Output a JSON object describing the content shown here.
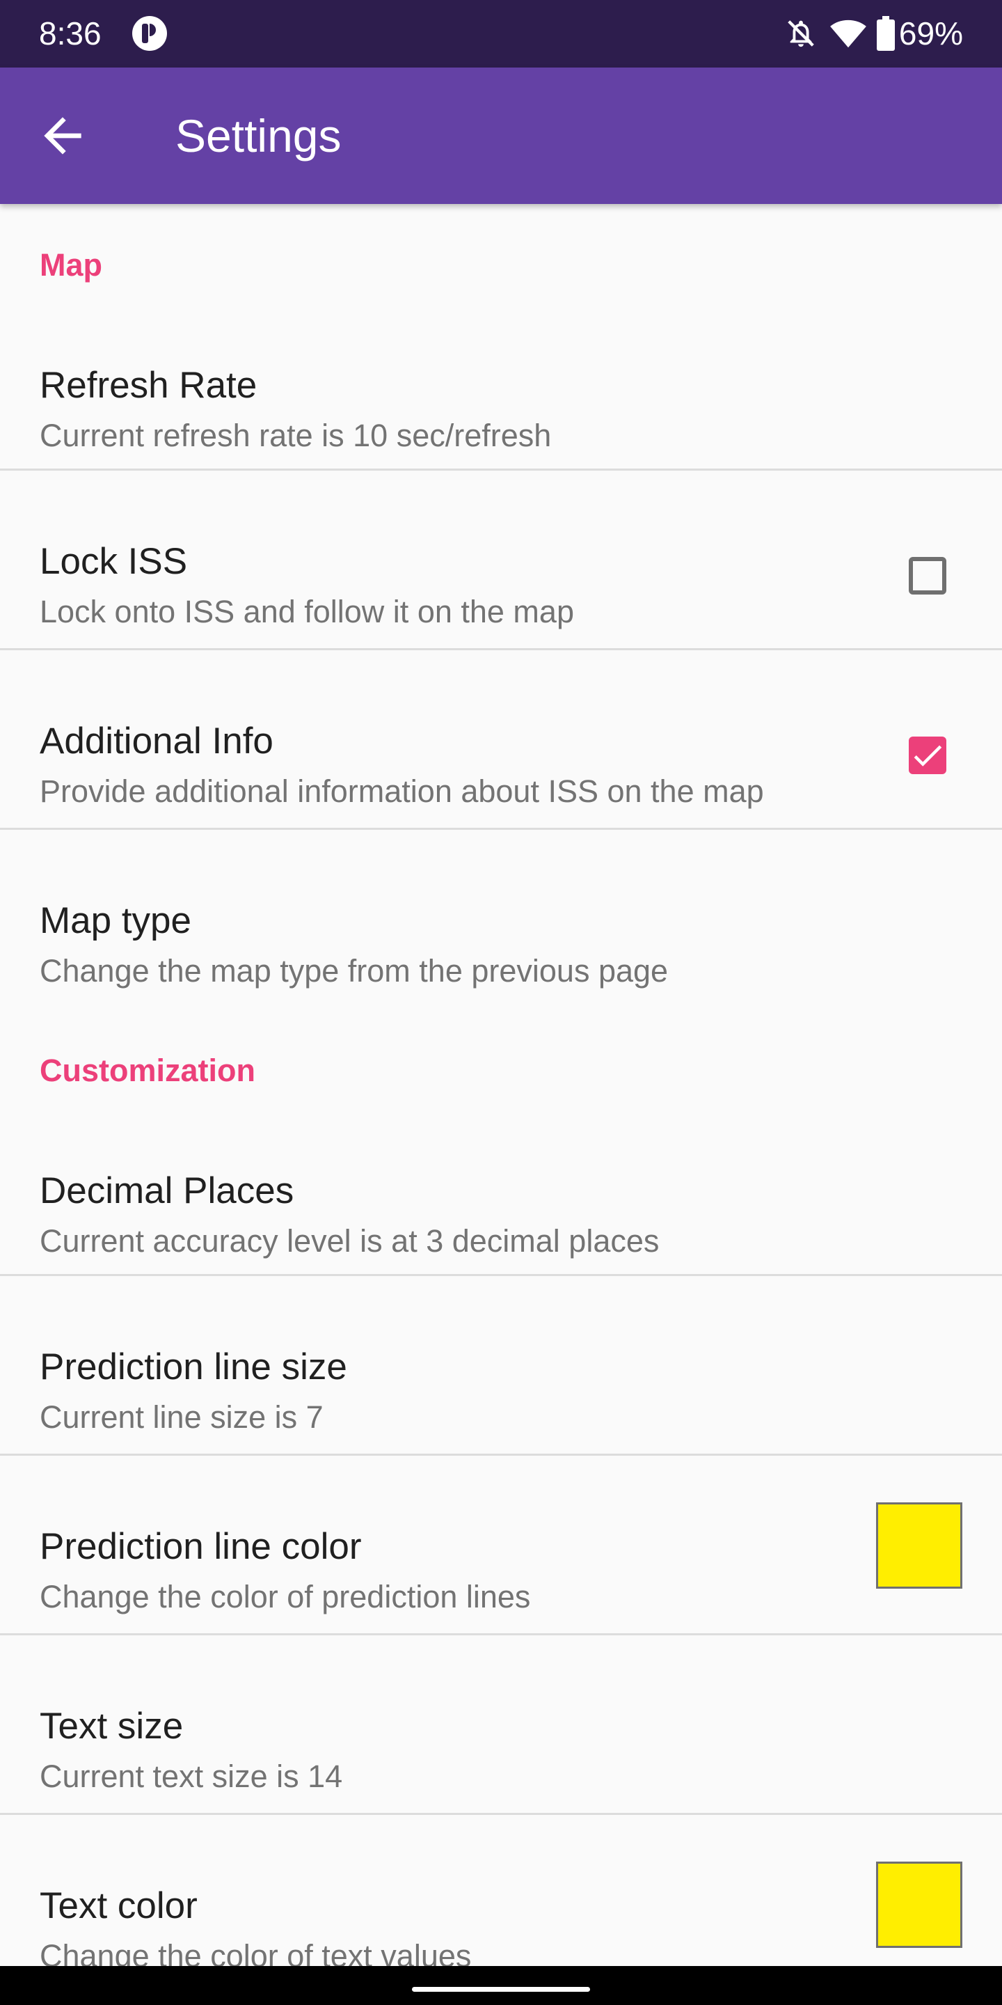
{
  "status_bar": {
    "time": "8:36",
    "battery": "69%",
    "icons": [
      "app-notification-icon",
      "notifications-off-icon",
      "wifi-icon",
      "battery-icon"
    ]
  },
  "app_bar": {
    "title": "Settings",
    "back_icon": "arrow-back-icon",
    "background_color": "#6441a5"
  },
  "accent_color": "#ec407a",
  "categories": {
    "map": "Map",
    "customization": "Customization"
  },
  "prefs": {
    "refresh_rate": {
      "title": "Refresh Rate",
      "summary": "Current refresh rate is 10 sec/refresh"
    },
    "lock_iss": {
      "title": "Lock ISS",
      "summary": "Lock onto ISS and follow it on the map",
      "checked": false
    },
    "additional_info": {
      "title": "Additional Info",
      "summary": "Provide additional information about ISS on the map",
      "checked": true
    },
    "map_type": {
      "title": "Map type",
      "summary": "Change the map type from the previous page"
    },
    "decimal_places": {
      "title": "Decimal Places",
      "summary": "Current accuracy level is at 3 decimal places"
    },
    "prediction_line_size": {
      "title": "Prediction line size",
      "summary": "Current line size is 7"
    },
    "prediction_line_color": {
      "title": "Prediction line color",
      "summary": "Change the color of prediction lines",
      "color": "#ffee00"
    },
    "text_size": {
      "title": "Text size",
      "summary": "Current text size is 14"
    },
    "text_color": {
      "title": "Text color",
      "summary": "Change the color of text values",
      "color": "#ffee00"
    }
  }
}
